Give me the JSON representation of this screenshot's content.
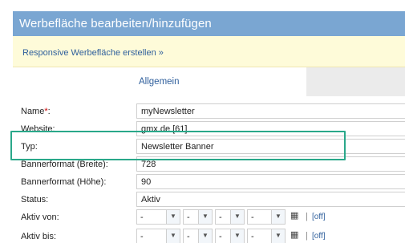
{
  "header": {
    "title": "Werbefläche bearbeiten/hinzufügen"
  },
  "notice": {
    "link": "Responsive Werbefläche erstellen »"
  },
  "tabs": {
    "general": "Allgemein"
  },
  "form": {
    "name": {
      "label": "Name",
      "required_mark": "*",
      "suffix": ":",
      "value": "myNewsletter"
    },
    "website": {
      "label": "Website:",
      "value": "gmx.de [61]"
    },
    "type": {
      "label": "Typ:",
      "value": "Newsletter Banner"
    },
    "width": {
      "label": "Bannerformat (Breite):",
      "value": "728"
    },
    "height": {
      "label": "Bannerformat (Höhe):",
      "value": "90"
    },
    "status": {
      "label": "Status:",
      "value": "Aktiv"
    },
    "active_from": {
      "label": "Aktiv von:",
      "date": "-",
      "hour": "-",
      "minute": "-",
      "second": "-",
      "separator": "|",
      "off": "[off]"
    },
    "active_to": {
      "label": "Aktiv bis:",
      "date": "-",
      "hour": "-",
      "minute": "-",
      "second": "-",
      "separator": "|",
      "off": "[off]"
    }
  }
}
